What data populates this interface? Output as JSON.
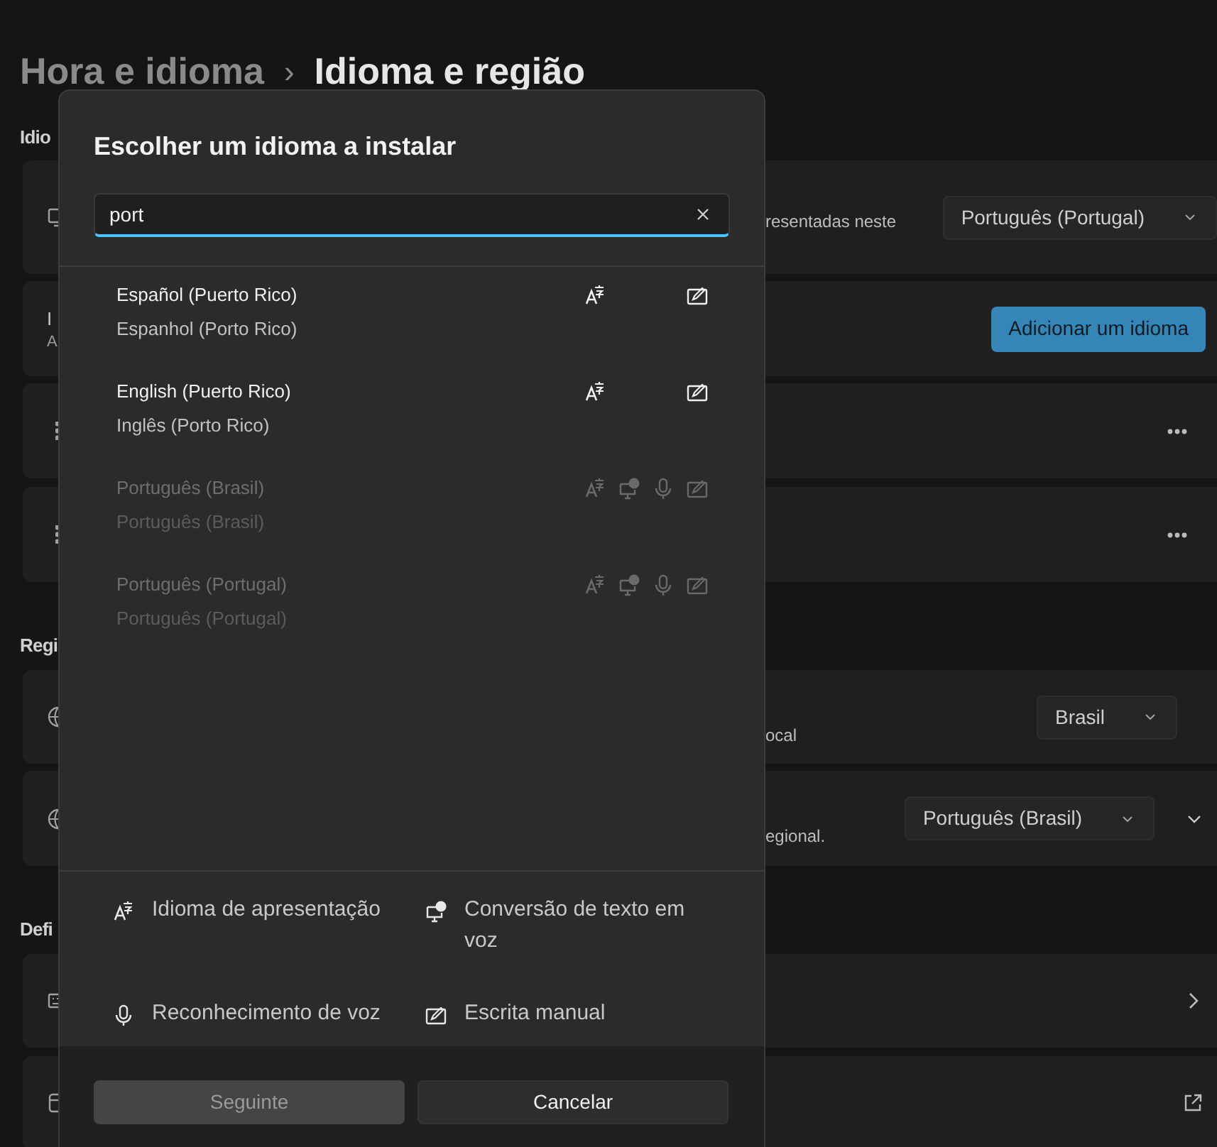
{
  "breadcrumb": {
    "parent": "Hora e idioma",
    "separator": "›",
    "current": "Idioma e região"
  },
  "sections": [
    {
      "label": "Idio",
      "cards": [
        {
          "kind": "dropdown",
          "text": "resentadas neste",
          "value": "Português (Portugal)"
        },
        {
          "kind": "button",
          "title": "I",
          "subtitle": "A",
          "button": "Adicionar um idioma"
        },
        {
          "kind": "more"
        },
        {
          "kind": "more"
        }
      ]
    },
    {
      "label": "Regi",
      "cards": [
        {
          "kind": "dropdown",
          "text": "ocal",
          "value": "Brasil"
        },
        {
          "kind": "dropdown_expand",
          "text": "egional.",
          "value": "Português (Brasil)"
        }
      ]
    },
    {
      "label": "Defi",
      "cards": [
        {
          "kind": "chevron"
        },
        {
          "kind": "link"
        }
      ]
    }
  ],
  "dialog": {
    "title": "Escolher um idioma a instalar",
    "search": {
      "value": "port"
    },
    "languages": [
      {
        "name": "Español (Puerto Rico)",
        "native": "Espanhol (Porto Rico)",
        "installed": false,
        "display": true,
        "tts": false,
        "speech": false,
        "handwriting": true
      },
      {
        "name": "English (Puerto Rico)",
        "native": "Inglês (Porto Rico)",
        "installed": false,
        "display": true,
        "tts": false,
        "speech": false,
        "handwriting": true
      },
      {
        "name": "Português (Brasil)",
        "native": "Português (Brasil)",
        "installed": true,
        "display": true,
        "tts": true,
        "speech": true,
        "handwriting": true
      },
      {
        "name": "Português (Portugal)",
        "native": "Português (Portugal)",
        "installed": true,
        "display": true,
        "tts": true,
        "speech": true,
        "handwriting": true
      }
    ],
    "legend": [
      {
        "kind": "display",
        "label": "Idioma de apresentação"
      },
      {
        "kind": "tts",
        "label": "Conversão de texto em voz"
      },
      {
        "kind": "speech",
        "label": "Reconhecimento de voz"
      },
      {
        "kind": "handwriting",
        "label": "Escrita manual"
      }
    ],
    "buttons": [
      {
        "label": "Seguinte",
        "disabled": true
      },
      {
        "label": "Cancelar",
        "disabled": false
      }
    ]
  }
}
